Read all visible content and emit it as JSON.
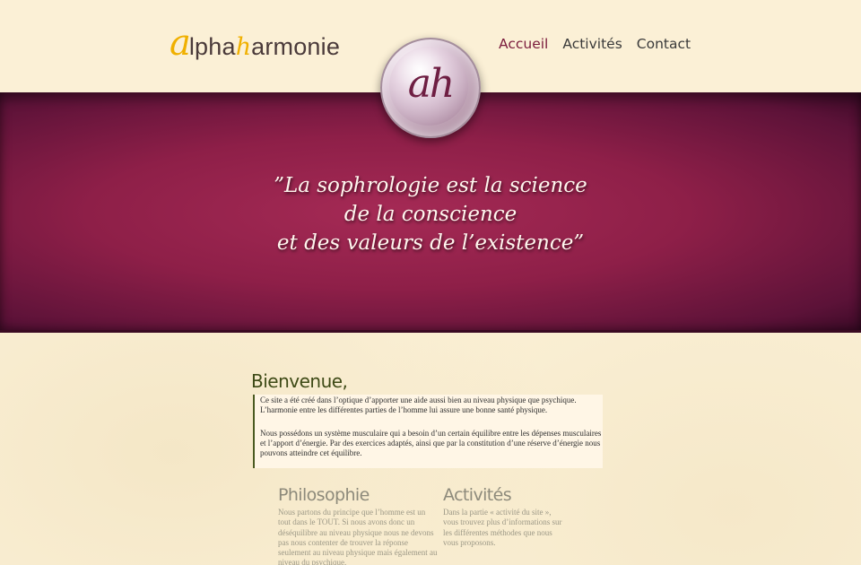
{
  "header": {
    "logo": {
      "a": "a",
      "part1": "lpha",
      "h": "h",
      "part2": "armonie"
    },
    "nav": [
      {
        "label": "Accueil"
      },
      {
        "label": "Activités"
      },
      {
        "label": "Contact"
      }
    ],
    "orb_letters": "ah"
  },
  "banner": {
    "quote_lines": [
      "”La sophrologie est la science",
      "de la conscience",
      "et des valeurs de l’existence”"
    ]
  },
  "welcome": {
    "title": "Bienvenue,",
    "paragraphs": [
      "Ce site a été créé dans l’optique d’apporter une aide aussi bien au niveau physique que psychique. L’harmonie entre les différentes parties de l’homme lui assure une bonne santé physique.",
      "Nous possédons un système musculaire qui a besoin d’un certain équilibre entre les dépenses musculaires et l’apport d’énergie. Par des exercices adaptés, ainsi que par la constitution d’une réserve d’énergie nous pouvons atteindre cet équilibre."
    ]
  },
  "columns": {
    "philosophie": {
      "title": "Philosophie",
      "text": "Nous partons du principe que l’homme est un tout dans le TOUT. Si nous avons donc un déséquilibre au niveau physique nous ne devons pas nous contenter de trouver la réponse seulement au niveau physique mais également au niveau du psychique."
    },
    "activites": {
      "title": "Activités",
      "text": "Dans la partie « activité du site », vous trouvez plus d’informations sur les différentes méthodes que nous vous proposons."
    }
  },
  "colors": {
    "accent": "#7a1b3c",
    "logo_yellow": "#f0b000",
    "banner": "#8e1f48",
    "background": "#fbf0d6"
  }
}
